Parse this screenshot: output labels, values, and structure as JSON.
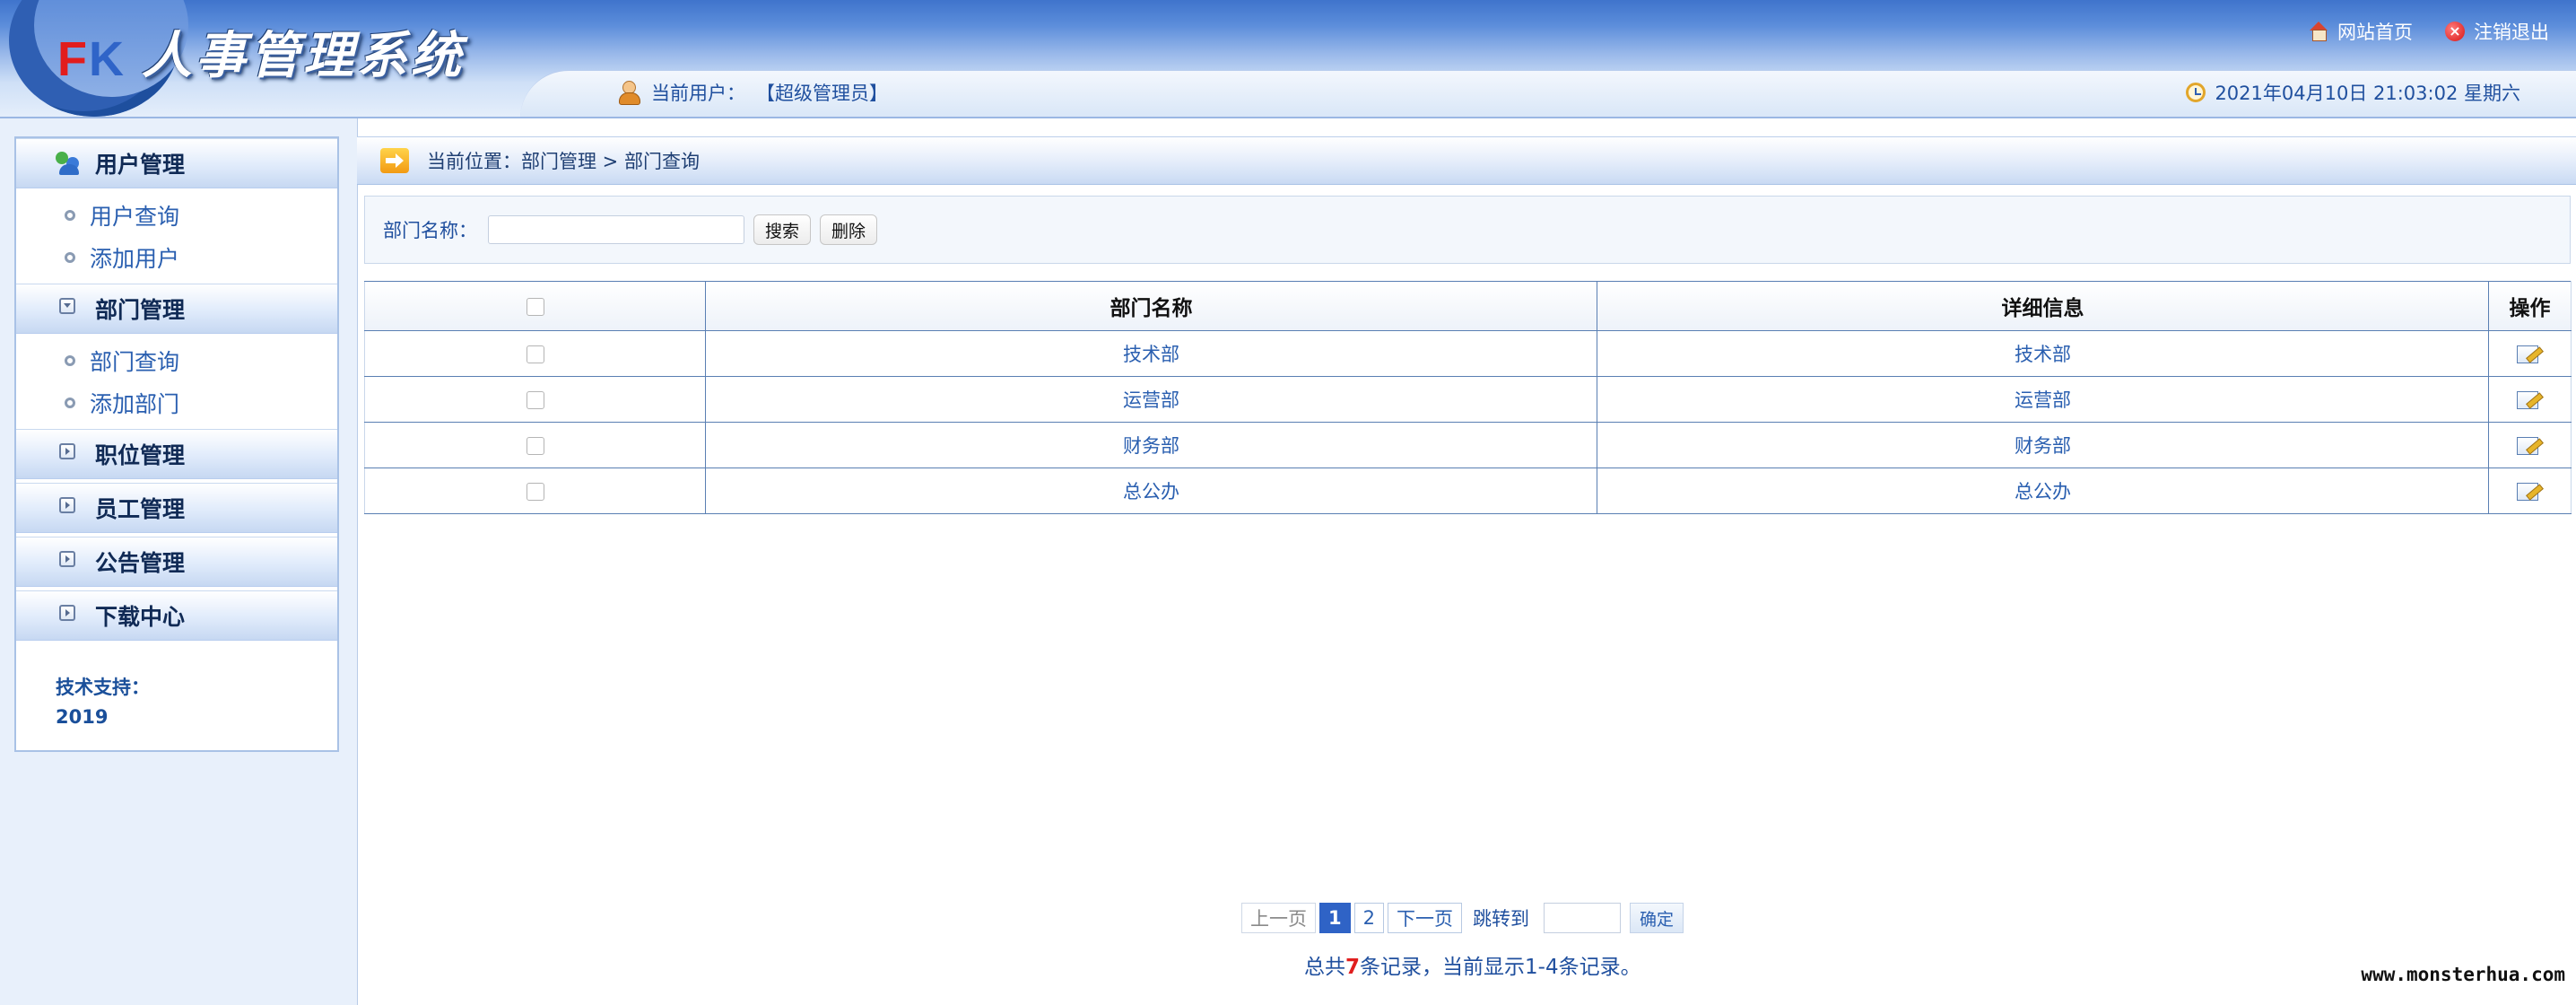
{
  "header": {
    "logo_prefix_f": "F",
    "logo_prefix_k": "K",
    "logo_title": "人事管理系统",
    "home_link": "网站首页",
    "logout_link": "注销退出",
    "current_user_label": "当前用户：",
    "current_user_value": "【超级管理员】",
    "datetime": "2021年04月10日 21:03:02 星期六"
  },
  "sidebar": {
    "menus": [
      {
        "title": "用户管理",
        "expanded": true,
        "items": [
          "用户查询",
          "添加用户"
        ]
      },
      {
        "title": "部门管理",
        "expanded": true,
        "items": [
          "部门查询",
          "添加部门"
        ]
      },
      {
        "title": "职位管理",
        "expanded": false,
        "items": []
      },
      {
        "title": "员工管理",
        "expanded": false,
        "items": []
      },
      {
        "title": "公告管理",
        "expanded": false,
        "items": []
      },
      {
        "title": "下载中心",
        "expanded": false,
        "items": []
      }
    ],
    "support_label": "技术支持：",
    "support_value": "2019"
  },
  "breadcrumb": {
    "text": "当前位置：部门管理 > 部门查询"
  },
  "search": {
    "label": "部门名称：",
    "value": "",
    "search_button": "搜索",
    "delete_button": "删除"
  },
  "table": {
    "headers": [
      "",
      "部门名称",
      "详细信息",
      "操作"
    ],
    "rows": [
      {
        "name": "技术部",
        "detail": "技术部"
      },
      {
        "name": "运营部",
        "detail": "运营部"
      },
      {
        "name": "财务部",
        "detail": "财务部"
      },
      {
        "name": "总公办",
        "detail": "总公办"
      }
    ]
  },
  "pagination": {
    "prev": "上一页",
    "pages": [
      "1",
      "2"
    ],
    "current": "1",
    "next": "下一页",
    "jump_label": "跳转到",
    "jump_value": "",
    "confirm": "确定",
    "summary_prefix": "总共",
    "total_count": "7",
    "summary_suffix": "条记录，当前显示1-4条记录。"
  },
  "footer": {
    "watermark": "www.monsterhua.com"
  },
  "colors": {
    "header_blue": "#3f74cc",
    "link_blue": "#2a5fb0",
    "table_border": "#5a7fb3",
    "active_page": "#2f63c6",
    "count_red": "#e01e1e"
  }
}
